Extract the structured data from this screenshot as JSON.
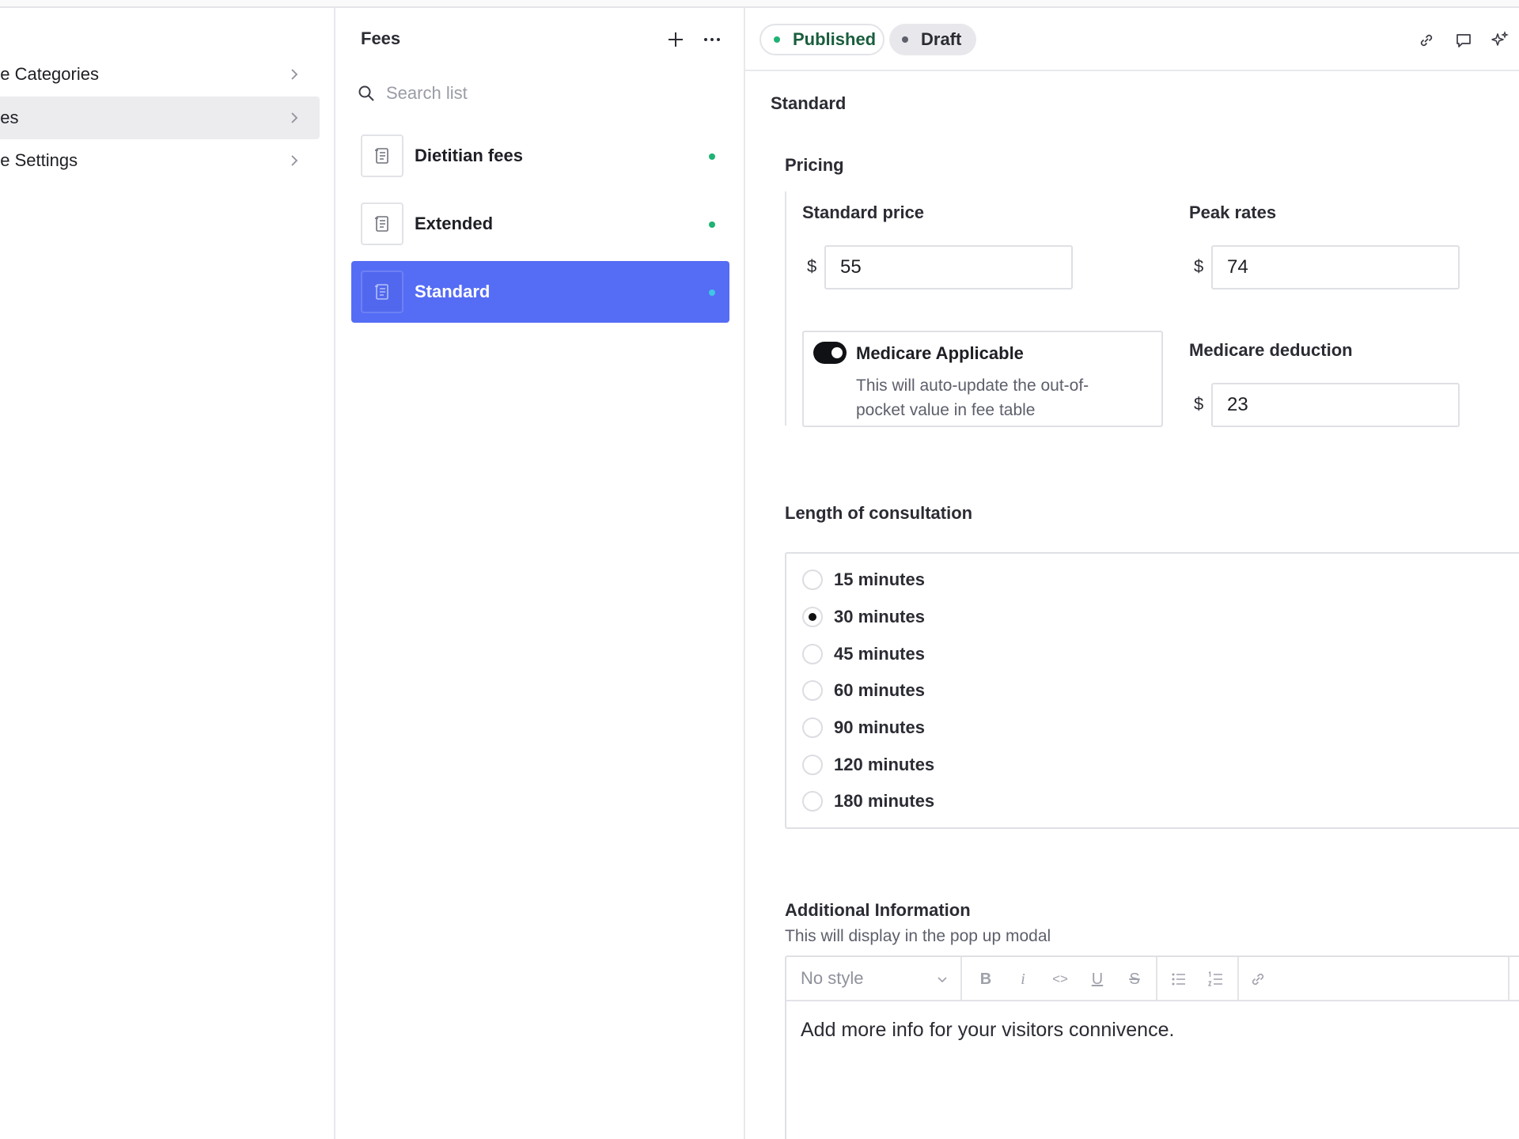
{
  "nav": {
    "items": [
      {
        "label": "ee Categories",
        "active": false
      },
      {
        "label": "ees",
        "active": true
      },
      {
        "label": "ee Settings",
        "active": false
      }
    ]
  },
  "list": {
    "title": "Fees",
    "search_placeholder": "Search list",
    "items": [
      {
        "label": "Dietitian fees",
        "selected": false
      },
      {
        "label": "Extended",
        "selected": false
      },
      {
        "label": "Standard",
        "selected": true
      }
    ]
  },
  "toolbar": {
    "published_label": "Published",
    "draft_label": "Draft"
  },
  "detail": {
    "title": "Standard",
    "pricing": {
      "section_title": "Pricing",
      "standard_price_label": "Standard price",
      "standard_price_value": "55",
      "peak_rates_label": "Peak rates",
      "peak_rates_value": "74",
      "currency": "$",
      "medicare_toggle_label": "Medicare Applicable",
      "medicare_toggle_on": true,
      "medicare_desc": "This will auto-update the out-of-pocket value in fee table",
      "medicare_deduction_label": "Medicare deduction",
      "medicare_deduction_value": "23"
    },
    "consultation": {
      "section_title": "Length of consultation",
      "options": [
        "15 minutes",
        "30 minutes",
        "45 minutes",
        "60 minutes",
        "90 minutes",
        "120 minutes",
        "180 minutes"
      ],
      "selected": "30 minutes"
    },
    "additional": {
      "section_title": "Additional Information",
      "description": "This will display in the pop up modal",
      "style_select": "No style",
      "format_buttons": [
        "B",
        "i",
        "<>",
        "U",
        "S"
      ],
      "body_text": "Add more info for your visitors connivence."
    }
  },
  "colors": {
    "accent": "#556cf5",
    "published_dot": "#1fb274",
    "draft_dot": "#5d5f6b"
  }
}
